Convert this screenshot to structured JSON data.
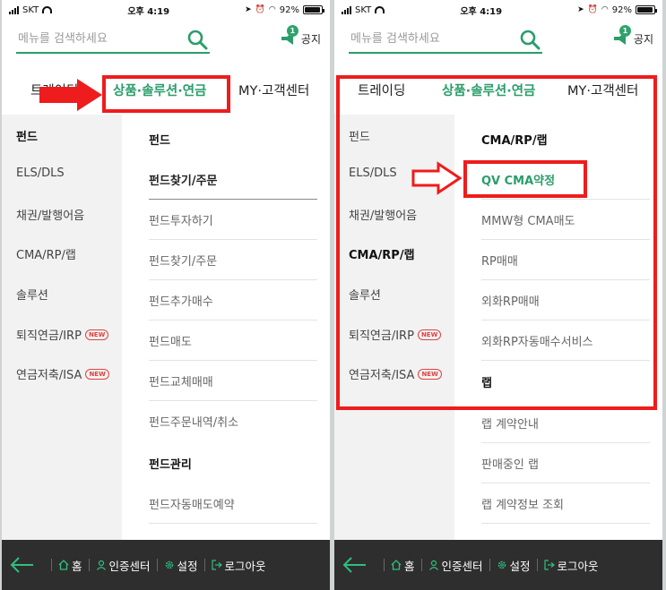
{
  "status_bar": {
    "carrier": "SKT",
    "time": "오후 4:19",
    "battery": "92%"
  },
  "search": {
    "placeholder": "메뉴를 검색하세요"
  },
  "notice": {
    "label": "공지",
    "count": "1"
  },
  "top_tabs": {
    "trading": "트레이딩",
    "products": "상품·솔루션·연금",
    "my": "MY·고객센터"
  },
  "new_badge": "NEW",
  "left_menu": [
    "펀드",
    "ELS/DLS",
    "채권/발행어음",
    "CMA/RP/랩",
    "솔루션",
    "퇴직연금/IRP",
    "연금저축/ISA"
  ],
  "screen1": {
    "active_left": "펀드",
    "right_items": [
      "펀드",
      "펀드찾기/주문",
      "펀드투자하기",
      "펀드찾기/주문",
      "펀드추가매수",
      "펀드매도",
      "펀드교체매매",
      "펀드주문내역/취소",
      "펀드관리",
      "펀드자동매도예약"
    ]
  },
  "screen2": {
    "active_left": "CMA/RP/랩",
    "right_items": [
      "CMA/RP/랩",
      "QV CMA약정",
      "MMW형 CMA매도",
      "RP매매",
      "외화RP매매",
      "외화RP자동매수서비스",
      "랩",
      "랩 계약안내",
      "판매중인 랩",
      "랩 계약정보 조회"
    ]
  },
  "bottom_bar": {
    "home": "홈",
    "cert": "인증센터",
    "settings": "설정",
    "logout": "로그아웃"
  },
  "colors": {
    "accent_green": "#2a9d6a",
    "annotation_red": "#ee1c1c",
    "bottom_bar": "#2e2e2e",
    "new_badge": "#e0423f"
  }
}
